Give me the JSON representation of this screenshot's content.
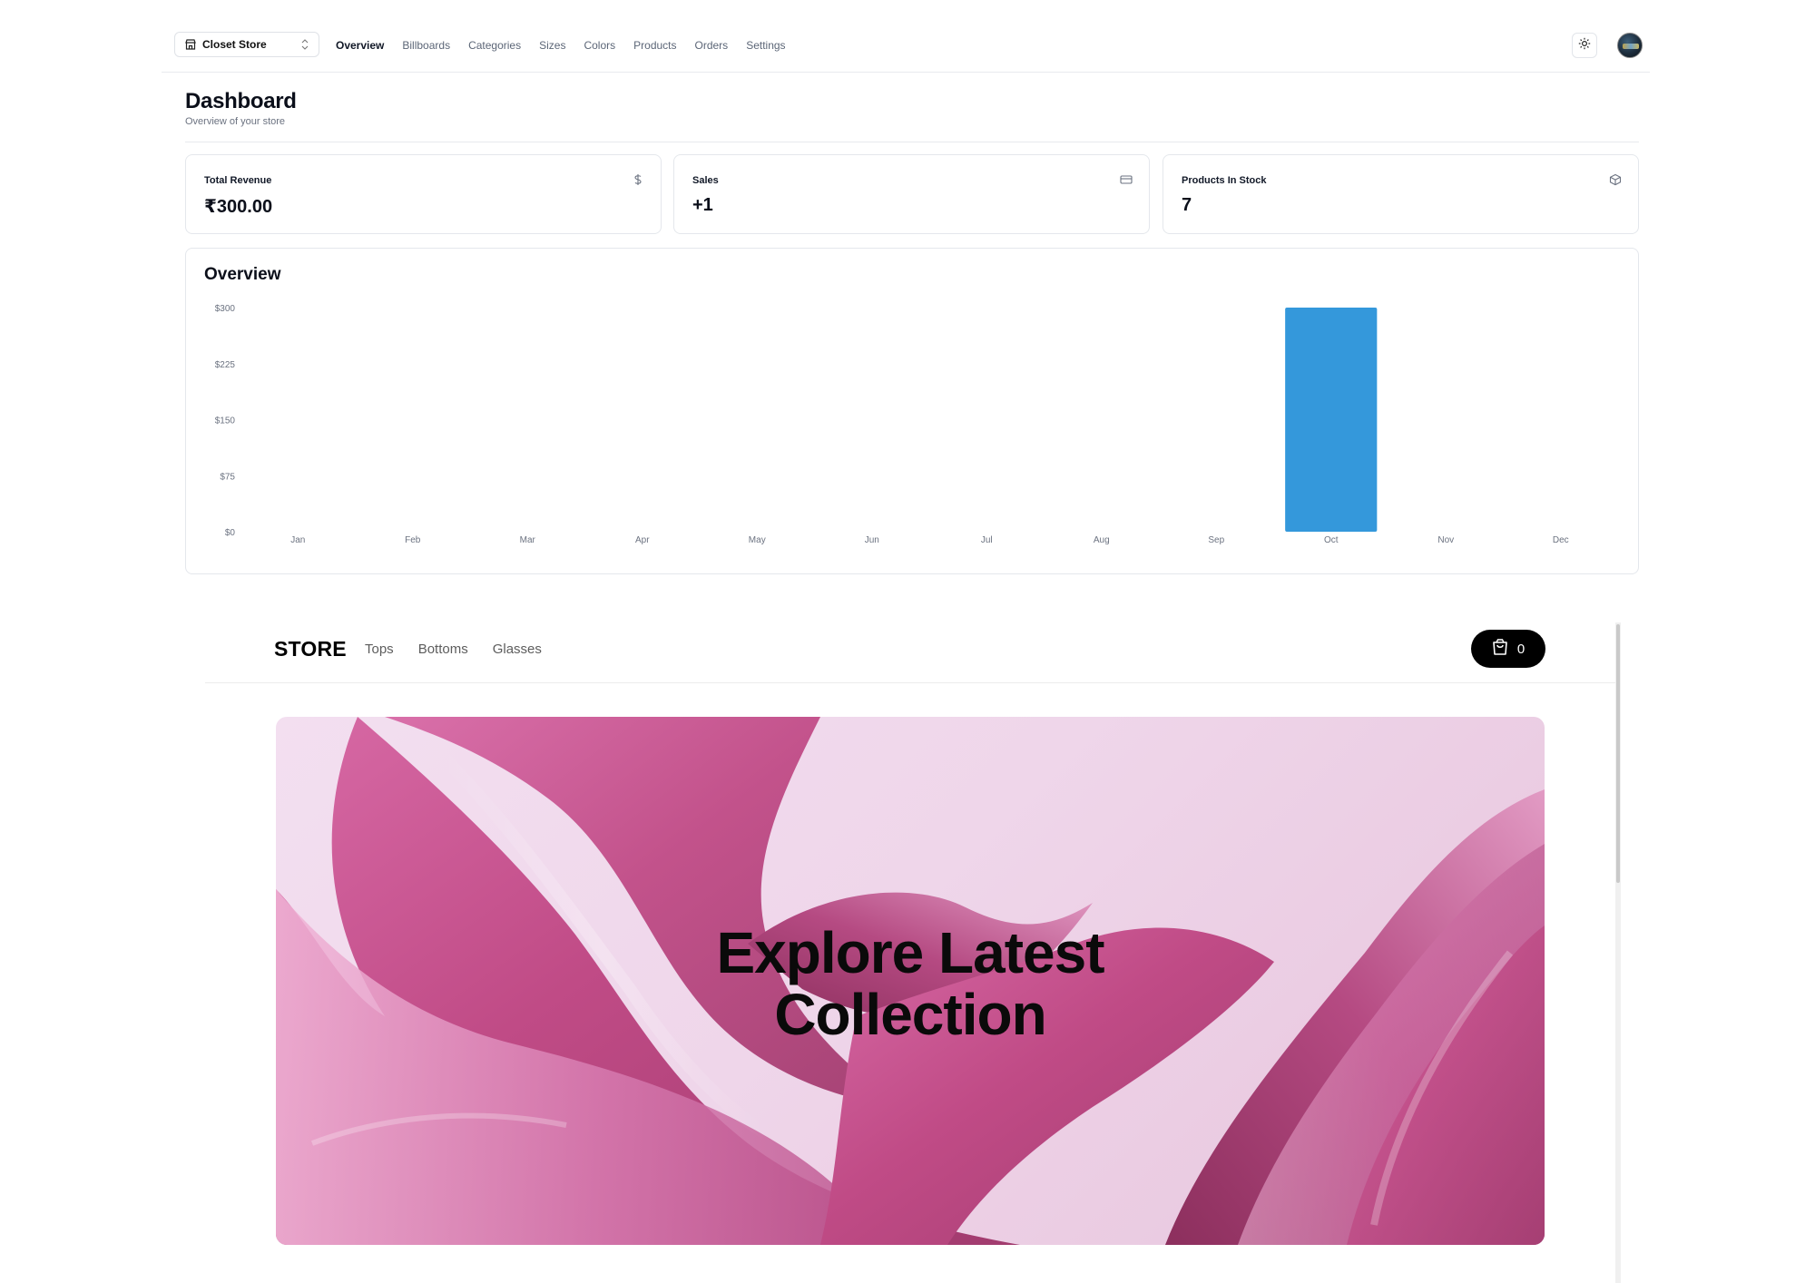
{
  "topnav": {
    "store_name": "Closet Store",
    "links": [
      "Overview",
      "Billboards",
      "Categories",
      "Sizes",
      "Colors",
      "Products",
      "Orders",
      "Settings"
    ],
    "active": "Overview"
  },
  "heading": {
    "title": "Dashboard",
    "subtitle": "Overview of your store"
  },
  "cards": {
    "revenue": {
      "label": "Total Revenue",
      "value": "₹300.00",
      "icon": "dollar-icon"
    },
    "sales": {
      "label": "Sales",
      "value": "+1",
      "icon": "credit-card-icon"
    },
    "stock": {
      "label": "Products In Stock",
      "value": "7",
      "icon": "package-icon"
    }
  },
  "overview": {
    "title": "Overview"
  },
  "chart_data": {
    "type": "bar",
    "title": "Overview",
    "categories": [
      "Jan",
      "Feb",
      "Mar",
      "Apr",
      "May",
      "Jun",
      "Jul",
      "Aug",
      "Sep",
      "Oct",
      "Nov",
      "Dec"
    ],
    "values": [
      0,
      0,
      0,
      0,
      0,
      0,
      0,
      0,
      0,
      300,
      0,
      0
    ],
    "ylim": [
      0,
      300
    ],
    "yticks": [
      "$0",
      "$75",
      "$150",
      "$225",
      "$300"
    ],
    "bar_color": "#3498db",
    "grid": false
  },
  "store": {
    "logo": "STORE",
    "links": [
      "Tops",
      "Bottoms",
      "Glasses"
    ],
    "cart_count": "0",
    "billboard_line1": "Explore Latest",
    "billboard_line2": "Collection"
  },
  "colors": {
    "accent_bar": "#3498db",
    "cart_button": "#000000",
    "billboard_fabric": "#c24d86"
  }
}
